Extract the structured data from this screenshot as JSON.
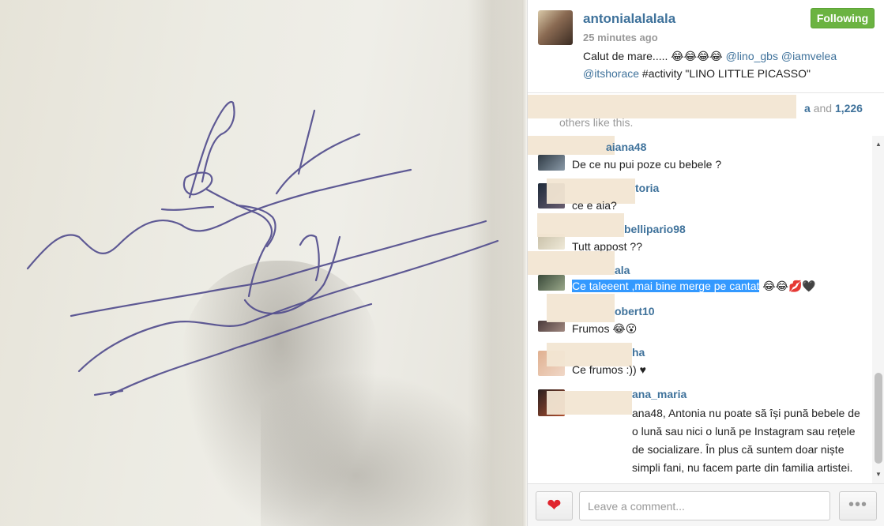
{
  "post": {
    "username": "antonialalalala",
    "follow_label": "Following",
    "time_ago": "25 minutes ago",
    "caption_text": "Calut de mare..... 😂😂😂😂",
    "caption_mention_1": "@lino_gbs",
    "caption_mention_2": "@iamvelea",
    "caption_mention_3": "@itshorace",
    "caption_tail": "#activity \"LINO LITTLE PICASSO\""
  },
  "likes": {
    "user_tail": "a",
    "and_text": "and",
    "count": "1,226",
    "others_text": "others like this."
  },
  "comments": [
    {
      "username": "aiana48",
      "text": "De ce nu pui poze cu bebele ?"
    },
    {
      "username": "toria",
      "text": "ce e aia?"
    },
    {
      "username": "bellipario98",
      "text": "Tutt appost ??"
    },
    {
      "username": "ala",
      "text_selected": "Ce taleeent ,mai bine merge pe cantat",
      "text_tail": "😂😂💋🖤"
    },
    {
      "username": "obert10",
      "text": "Frumos 😂😮"
    },
    {
      "username": "ha",
      "text": "Ce frumos :)) ♥"
    },
    {
      "username": "ana_maria",
      "text": "ana48, Antonia nu poate să își pună bebele de o lună sau nici o lună pe Instagram sau rețele de socializare. În plus că suntem doar niște simpli fani, nu facem parte din familia artistei."
    }
  ],
  "footer": {
    "like_icon": "heart-icon",
    "comment_placeholder": "Leave a comment...",
    "more_label": "•••"
  },
  "colors": {
    "link": "#3f729b",
    "follow_green": "#6bb341",
    "heart_red": "#e0242d",
    "selection": "#3399ff"
  }
}
